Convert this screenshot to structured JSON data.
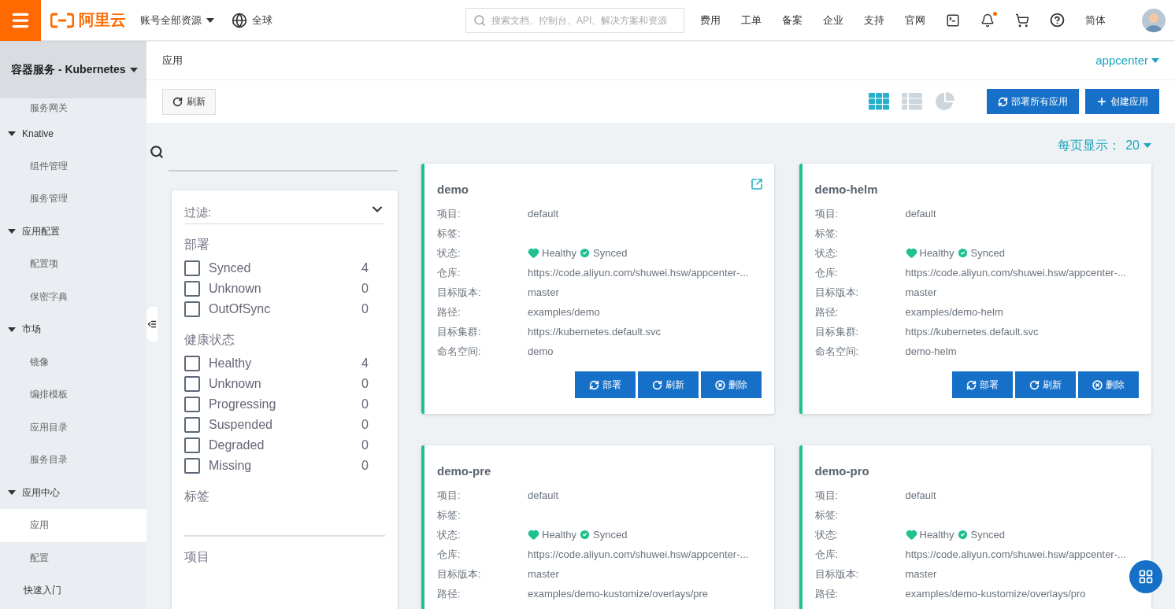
{
  "header": {
    "logo": "阿里云",
    "account": "账号全部资源",
    "region": "全球",
    "search": {
      "placeholder": "搜索文档、控制台、API、解决方案和资源"
    },
    "links": [
      "费用",
      "工单",
      "备案",
      "企业",
      "支持",
      "官网"
    ],
    "notification": true,
    "language": "简体"
  },
  "sidebar": {
    "title": "容器服务 - Kubernetes",
    "items": [
      {
        "kind": "sub",
        "label": "服务网关",
        "selected": false
      },
      {
        "kind": "group",
        "label": "Knative",
        "expanded": true,
        "children": [
          {
            "label": "组件管理",
            "selected": false
          },
          {
            "label": "服务管理",
            "selected": false
          }
        ]
      },
      {
        "kind": "group",
        "label": "应用配置",
        "expanded": true,
        "children": [
          {
            "label": "配置项",
            "selected": false
          },
          {
            "label": "保密字典",
            "selected": false
          }
        ]
      },
      {
        "kind": "group",
        "label": "市场",
        "expanded": true,
        "children": [
          {
            "label": "镜像",
            "selected": false
          },
          {
            "label": "编排模板",
            "selected": false
          },
          {
            "label": "应用目录",
            "selected": false
          },
          {
            "label": "服务目录",
            "selected": false
          }
        ]
      },
      {
        "kind": "group",
        "label": "应用中心",
        "expanded": true,
        "children": [
          {
            "label": "应用",
            "selected": true
          },
          {
            "label": "配置",
            "selected": false
          }
        ]
      },
      {
        "kind": "link",
        "label": "快速入门",
        "selected": false
      }
    ]
  },
  "breadcrumb": "应用",
  "namespace": "appcenter",
  "toolbar": {
    "refresh": "刷新",
    "views": [
      {
        "kind": "grid",
        "selected": true
      },
      {
        "kind": "list",
        "selected": false
      },
      {
        "kind": "pie",
        "selected": false
      }
    ],
    "buttons": [
      {
        "kind": "sync",
        "label": "部署所有应用"
      },
      {
        "kind": "plus",
        "label": "创建应用"
      }
    ]
  },
  "page_size": {
    "label": "每页显示：",
    "value": "20"
  },
  "filter": {
    "title": "过滤:",
    "expanded": true,
    "sections": [
      {
        "title": "部署",
        "options": [
          {
            "label": "Synced",
            "count": "4",
            "checked": false
          },
          {
            "label": "Unknown",
            "count": "0",
            "checked": false
          },
          {
            "label": "OutOfSync",
            "count": "0",
            "checked": false
          }
        ]
      },
      {
        "title": "健康状态",
        "options": [
          {
            "label": "Healthy",
            "count": "4",
            "checked": false
          },
          {
            "label": "Unknown",
            "count": "0",
            "checked": false
          },
          {
            "label": "Progressing",
            "count": "0",
            "checked": false
          },
          {
            "label": "Suspended",
            "count": "0",
            "checked": false
          },
          {
            "label": "Degraded",
            "count": "0",
            "checked": false
          },
          {
            "label": "Missing",
            "count": "0",
            "checked": false
          }
        ]
      },
      {
        "title": "标签",
        "divider": true
      },
      {
        "title": "项目"
      }
    ]
  },
  "cards": [
    {
      "name": "demo",
      "link_icon": true,
      "rows": [
        {
          "kind": "text",
          "label": "项目:",
          "value": "default"
        },
        {
          "kind": "text",
          "label": "标签:"
        },
        {
          "kind": "status",
          "label": "状态:",
          "health": "Healthy",
          "sync": "Synced"
        },
        {
          "kind": "text",
          "label": "仓库:",
          "value": "https://code.aliyun.com/shuwei.hsw/appcenter-..."
        },
        {
          "kind": "text",
          "label": "目标版本:",
          "value": "master"
        },
        {
          "kind": "text",
          "label": "路径:",
          "value": "examples/demo"
        },
        {
          "kind": "text",
          "label": "目标集群:",
          "value": "https://kubernetes.default.svc"
        },
        {
          "kind": "text",
          "label": "命名空间:",
          "value": "demo"
        }
      ],
      "buttons": [
        {
          "kind": "sync",
          "label": "部署"
        },
        {
          "kind": "refresh",
          "label": "刷新"
        },
        {
          "kind": "delete",
          "label": "删除"
        }
      ]
    },
    {
      "name": "demo-helm",
      "link_icon": false,
      "rows": [
        {
          "kind": "text",
          "label": "项目:",
          "value": "default"
        },
        {
          "kind": "text",
          "label": "标签:"
        },
        {
          "kind": "status",
          "label": "状态:",
          "health": "Healthy",
          "sync": "Synced"
        },
        {
          "kind": "text",
          "label": "仓库:",
          "value": "https://code.aliyun.com/shuwei.hsw/appcenter-..."
        },
        {
          "kind": "text",
          "label": "目标版本:",
          "value": "master"
        },
        {
          "kind": "text",
          "label": "路径:",
          "value": "examples/demo-helm"
        },
        {
          "kind": "text",
          "label": "目标集群:",
          "value": "https://kubernetes.default.svc"
        },
        {
          "kind": "text",
          "label": "命名空间:",
          "value": "demo-helm"
        }
      ],
      "buttons": [
        {
          "kind": "sync",
          "label": "部署"
        },
        {
          "kind": "refresh",
          "label": "刷新"
        },
        {
          "kind": "delete",
          "label": "删除"
        }
      ]
    },
    {
      "name": "demo-pre",
      "link_icon": false,
      "rows": [
        {
          "kind": "text",
          "label": "项目:",
          "value": "default"
        },
        {
          "kind": "text",
          "label": "标签:"
        },
        {
          "kind": "status",
          "label": "状态:",
          "health": "Healthy",
          "sync": "Synced"
        },
        {
          "kind": "text",
          "label": "仓库:",
          "value": "https://code.aliyun.com/shuwei.hsw/appcenter-..."
        },
        {
          "kind": "text",
          "label": "目标版本:",
          "value": "master"
        },
        {
          "kind": "text",
          "label": "路径:",
          "value": "examples/demo-kustomize/overlays/pre"
        }
      ]
    },
    {
      "name": "demo-pro",
      "link_icon": false,
      "rows": [
        {
          "kind": "text",
          "label": "项目:",
          "value": "default"
        },
        {
          "kind": "text",
          "label": "标签:"
        },
        {
          "kind": "status",
          "label": "状态:",
          "health": "Healthy",
          "sync": "Synced"
        },
        {
          "kind": "text",
          "label": "仓库:",
          "value": "https://code.aliyun.com/shuwei.hsw/appcenter-..."
        },
        {
          "kind": "text",
          "label": "目标版本:",
          "value": "master"
        },
        {
          "kind": "text",
          "label": "路径:",
          "value": "examples/demo-kustomize/overlays/pro"
        }
      ]
    }
  ]
}
